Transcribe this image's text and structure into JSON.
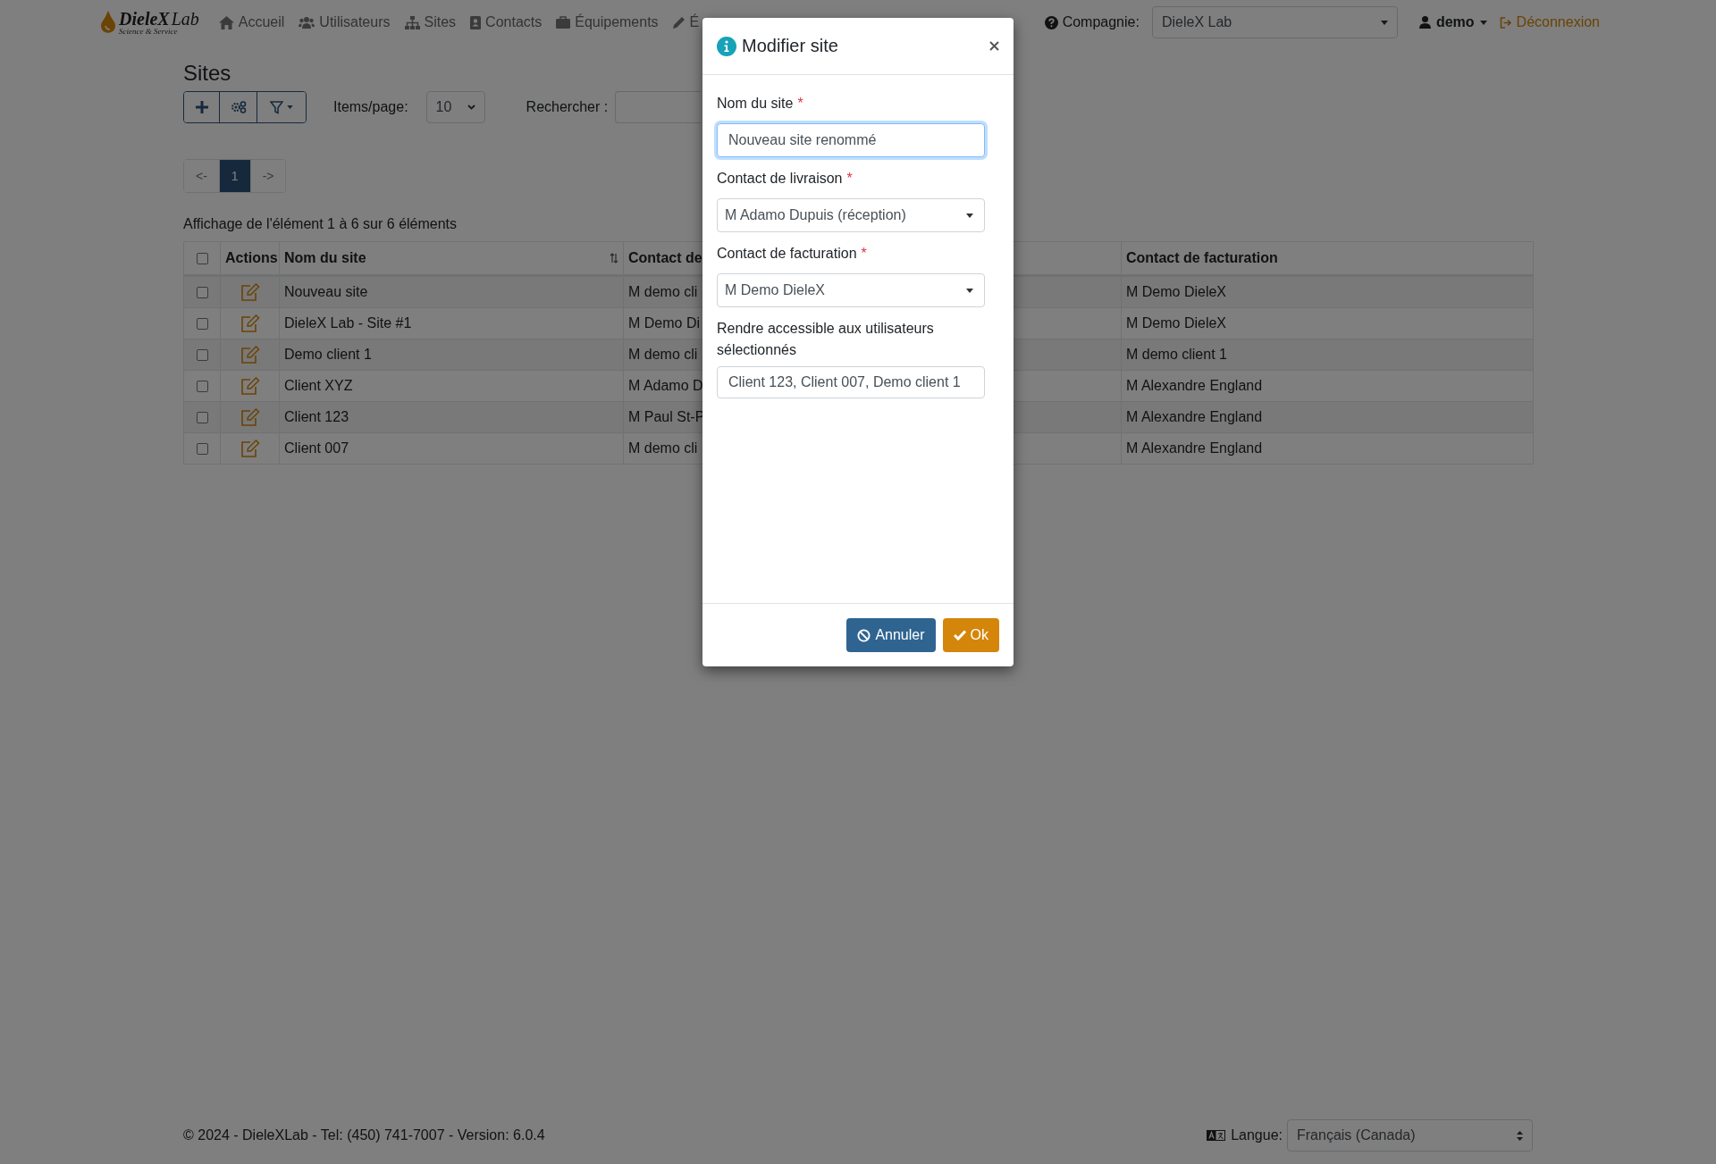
{
  "navbar": {
    "logo": {
      "brand": "DieleX",
      "suffix": "Lab",
      "tagline": "Science & Service"
    },
    "items": [
      {
        "label": "Accueil",
        "kind": "home"
      },
      {
        "label": "Utilisateurs",
        "kind": "users"
      },
      {
        "label": "Sites",
        "kind": "sitemap"
      },
      {
        "label": "Contacts",
        "kind": "card"
      },
      {
        "label": "Équipements",
        "kind": "briefcase"
      },
      {
        "label": "É",
        "kind": "pencil"
      }
    ],
    "company_label": "Compagnie:",
    "company_value": "DieleX Lab",
    "user": "demo",
    "logout": "Déconnexion"
  },
  "page": {
    "title": "Sites",
    "items_per_page_label": "Items/page:",
    "items_per_page": "10",
    "search_label": "Rechercher :",
    "pagination": [
      {
        "label": "<-",
        "selected": false
      },
      {
        "label": "1",
        "selected": true
      },
      {
        "label": "->",
        "selected": false
      }
    ],
    "summary": "Affichage de l'élément 1 à 6 sur 6 éléments"
  },
  "table": {
    "select_all_checked": false,
    "columns": [
      {
        "label": "Actions",
        "sortable": false
      },
      {
        "label": "Nom du site",
        "sortable": true
      },
      {
        "label": "Contact de",
        "sortable": false
      },
      {
        "label": "Contact de facturation",
        "sortable": false
      }
    ],
    "rows": [
      {
        "checked": false,
        "name": "Nouveau site",
        "delivery_contact": "M demo cli",
        "billing_contact": "M Demo DieleX"
      },
      {
        "checked": false,
        "name": "DieleX Lab - Site #1",
        "delivery_contact": "M Demo Di",
        "billing_contact": "M Demo DieleX"
      },
      {
        "checked": false,
        "name": "Demo client 1",
        "delivery_contact": "M demo cli",
        "billing_contact": "M demo client 1"
      },
      {
        "checked": false,
        "name": "Client XYZ",
        "delivery_contact": "M Adamo D",
        "billing_contact": "M Alexandre England"
      },
      {
        "checked": false,
        "name": "Client 123",
        "delivery_contact": "M Paul St-P",
        "billing_contact": "M Alexandre England"
      },
      {
        "checked": false,
        "name": "Client 007",
        "delivery_contact": "M demo cli",
        "billing_contact": "M Alexandre England"
      }
    ]
  },
  "modal": {
    "title": "Modifier site",
    "fields": [
      {
        "kind": "text",
        "label": "Nom du site",
        "required_mark": "*",
        "value": "Nouveau site renommé",
        "focused": true
      },
      {
        "kind": "select",
        "label": "Contact de livraison",
        "required_mark": "*",
        "value": "M Adamo Dupuis (réception)",
        "focused": false
      },
      {
        "kind": "select",
        "label": "Contact de facturation",
        "required_mark": "*",
        "value": "M Demo DieleX",
        "focused": false
      },
      {
        "kind": "multiselect",
        "label": "Rendre accessible aux utilisateurs sélectionnés",
        "value": "Client 123, Client 007, Demo client 1",
        "focused": false
      }
    ],
    "buttons": [
      {
        "label": "Annuler",
        "kind": "cancel"
      },
      {
        "label": "Ok",
        "kind": "ok"
      }
    ]
  },
  "footer": {
    "text": "© 2024 - DieleXLab - Tel: (450) 741-7007 - Version: 6.0.4",
    "language_label": "Langue:",
    "language_value": "Français (Canada)"
  }
}
